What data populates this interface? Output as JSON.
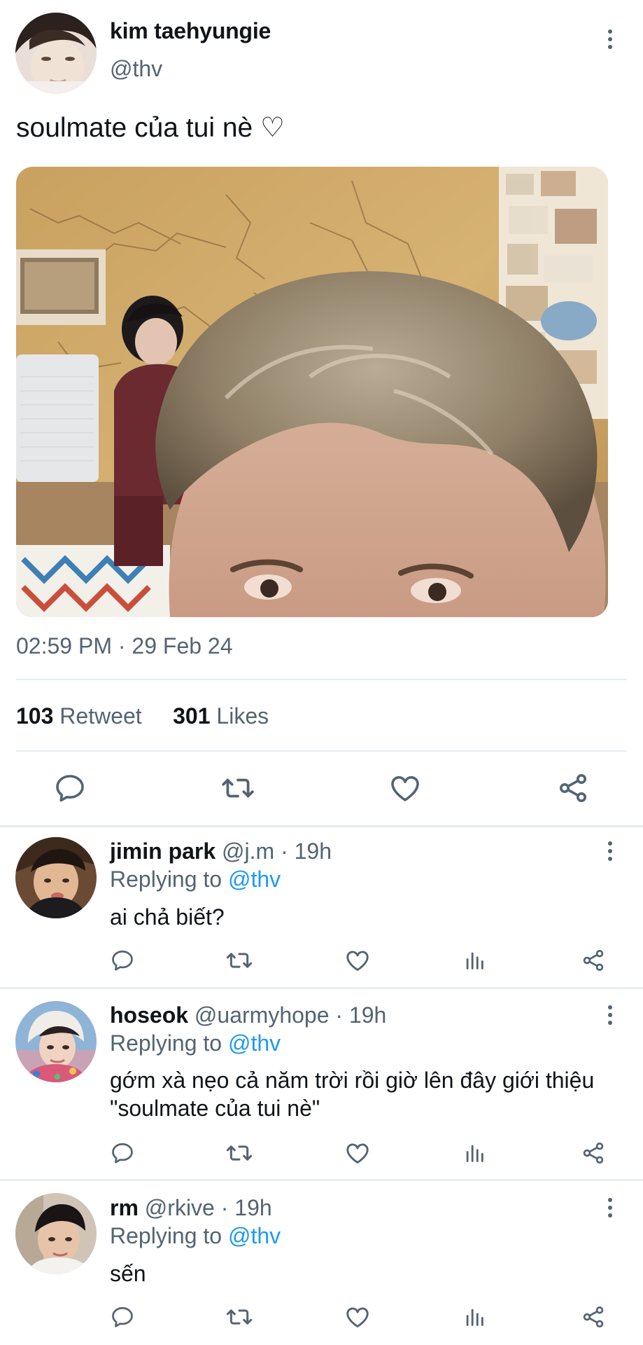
{
  "tweet": {
    "author_name": "kim taehyungie",
    "author_handle": "@thv",
    "text": "soulmate của tui nè ♡",
    "timestamp": "02:59 PM · 29 Feb 24",
    "retweet_count": "103",
    "retweet_label": "Retweet",
    "like_count": "301",
    "like_label": "Likes"
  },
  "replies": [
    {
      "name": "jimin park",
      "meta": "@j.m · 19h",
      "replying_prefix": "Replying to",
      "mention": "@thv",
      "text": "ai chả biết?"
    },
    {
      "name": "hoseok",
      "meta": "@uarmyhope · 19h",
      "replying_prefix": "Replying to",
      "mention": "@thv",
      "text": "gớm xà nẹo cả năm trời rồi giờ lên đây giới thiệu \"soulmate của tui nè\""
    },
    {
      "name": "rm",
      "meta": "@rkive · 19h",
      "replying_prefix": "Replying to",
      "mention": "@thv",
      "text": "sến"
    }
  ],
  "icons": {
    "more": "more-vertical-icon",
    "reply": "comment-bubble-icon",
    "retweet": "retweet-arrows-icon",
    "like": "heart-outline-icon",
    "views": "bar-chart-icon",
    "share": "share-nodes-icon"
  },
  "colors": {
    "text": "#0f1419",
    "secondary": "#536471",
    "accent": "#1d9bf0",
    "divider": "#e6ecf0"
  }
}
